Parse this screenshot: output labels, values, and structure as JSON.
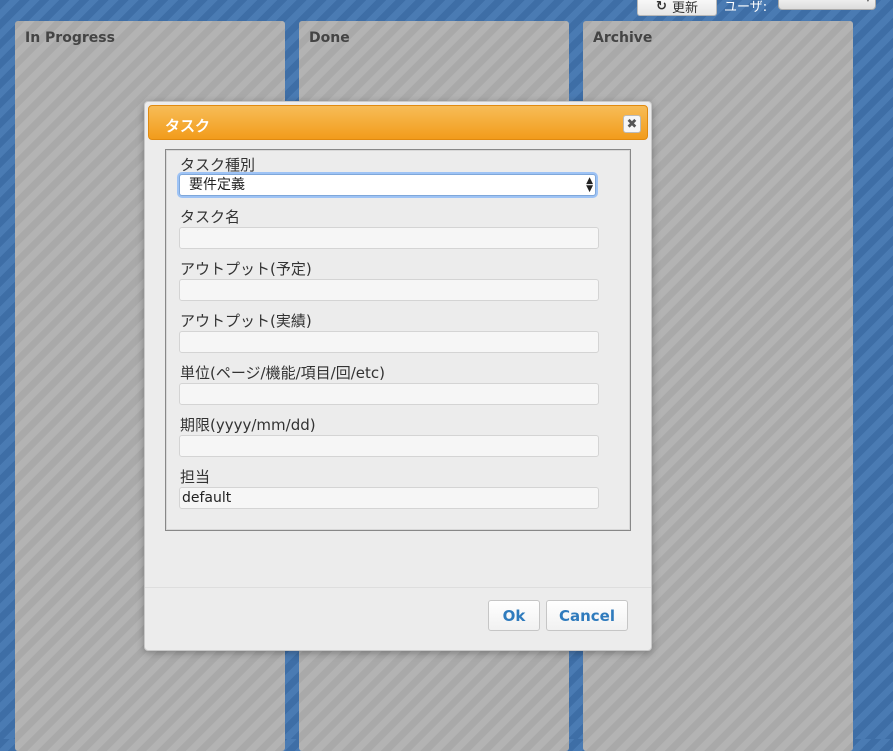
{
  "toolbar": {
    "refresh_icon": "refresh-icon",
    "refresh_label": "更新",
    "user_label": "ユーザ:",
    "user_select_value": ""
  },
  "columns": [
    {
      "title": "In Progress"
    },
    {
      "title": "Done"
    },
    {
      "title": "Archive"
    }
  ],
  "modal": {
    "title": "タスク",
    "close_icon": "close-icon",
    "fields": {
      "task_type": {
        "label": "タスク種別",
        "value": "要件定義"
      },
      "task_name": {
        "label": "タスク名",
        "value": ""
      },
      "output_planned": {
        "label": "アウトプット(予定)",
        "value": ""
      },
      "output_actual": {
        "label": "アウトプット(実績)",
        "value": ""
      },
      "unit": {
        "label": "単位(ページ/機能/項目/回/etc)",
        "value": ""
      },
      "deadline": {
        "label": "期限(yyyy/mm/dd)",
        "value": ""
      },
      "assignee": {
        "label": "担当",
        "value": "default"
      }
    },
    "ok_label": "Ok",
    "cancel_label": "Cancel"
  },
  "colors": {
    "header_orange": "#f29c1b",
    "background_blue": "#3e6ea6",
    "button_text_blue": "#2f7bbd"
  }
}
